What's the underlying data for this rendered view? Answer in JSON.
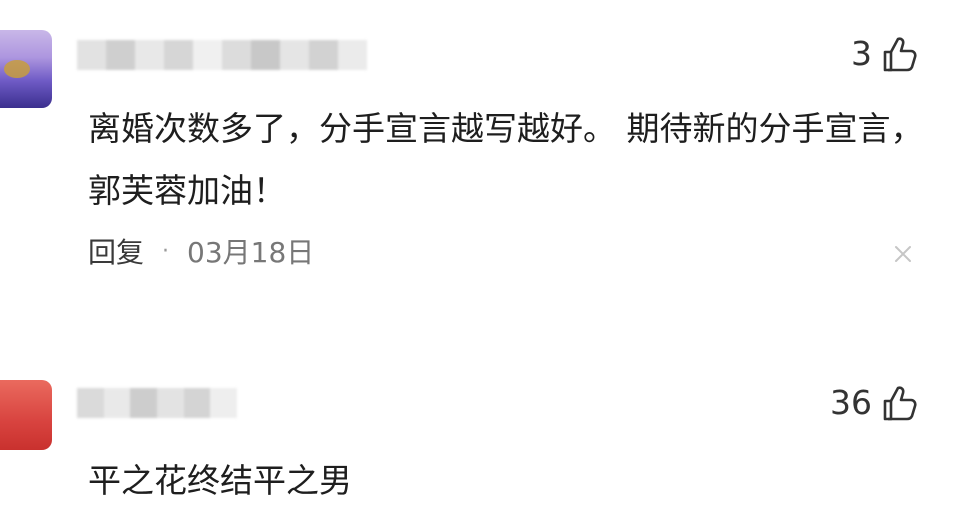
{
  "comments": [
    {
      "content": "离婚次数多了，分手宣言越写越好。 期待新的分手宣言， 郭芙蓉加油！",
      "likes": "3",
      "reply_label": "回复",
      "separator": "·",
      "date": "03月18日"
    },
    {
      "content": "平之花终结平之男",
      "likes": "36"
    }
  ],
  "colors": {
    "text": "#1e1e1e",
    "meta_text": "#555555",
    "avatar_1": "#6f5bc6",
    "avatar_2": "#d8433f"
  },
  "icons": {
    "like": "thumbs-up-icon",
    "close": "close-icon"
  }
}
